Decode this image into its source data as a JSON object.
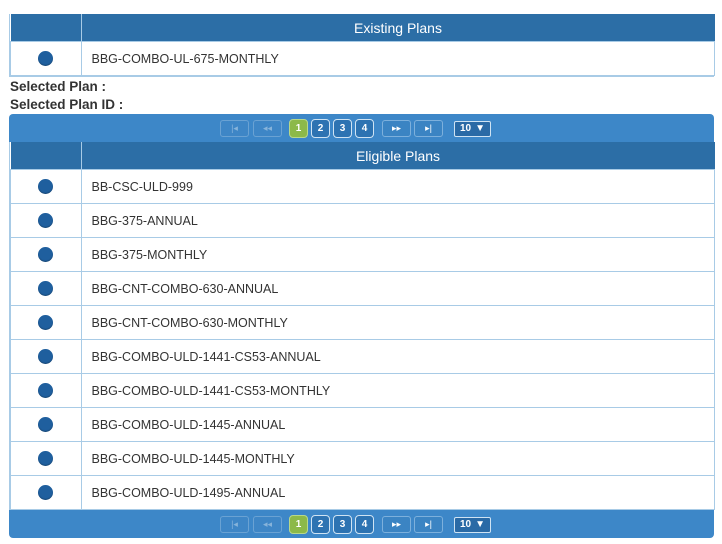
{
  "existing": {
    "header_select": "",
    "header_name": "Existing Plans",
    "rows": [
      {
        "name": "BBG-COMBO-UL-675-MONTHLY"
      }
    ]
  },
  "selection": {
    "selected_plan_label": "Selected Plan :",
    "selected_plan_id_label": "Selected Plan ID :"
  },
  "pager": {
    "first": "|◂",
    "prev": "◂◂",
    "pages": [
      "1",
      "2",
      "3",
      "4"
    ],
    "current_page": "1",
    "next": "▸▸",
    "last": "▸|",
    "page_size": "10",
    "page_size_caret": "▼"
  },
  "eligible": {
    "header_select": "",
    "header_name": "Eligible Plans",
    "rows": [
      {
        "name": "BB-CSC-ULD-999"
      },
      {
        "name": "BBG-375-ANNUAL"
      },
      {
        "name": "BBG-375-MONTHLY"
      },
      {
        "name": "BBG-CNT-COMBO-630-ANNUAL"
      },
      {
        "name": "BBG-CNT-COMBO-630-MONTHLY"
      },
      {
        "name": "BBG-COMBO-ULD-1441-CS53-ANNUAL"
      },
      {
        "name": "BBG-COMBO-ULD-1441-CS53-MONTHLY"
      },
      {
        "name": "BBG-COMBO-ULD-1445-ANNUAL"
      },
      {
        "name": "BBG-COMBO-ULD-1445-MONTHLY"
      },
      {
        "name": "BBG-COMBO-ULD-1495-ANNUAL"
      }
    ]
  },
  "colors": {
    "header_bg": "#2c6ea6",
    "pager_bg": "#3d87c8",
    "radio": "#1f5f9e",
    "current_page": "#8cb949",
    "grid_line": "#a8cbe6"
  }
}
